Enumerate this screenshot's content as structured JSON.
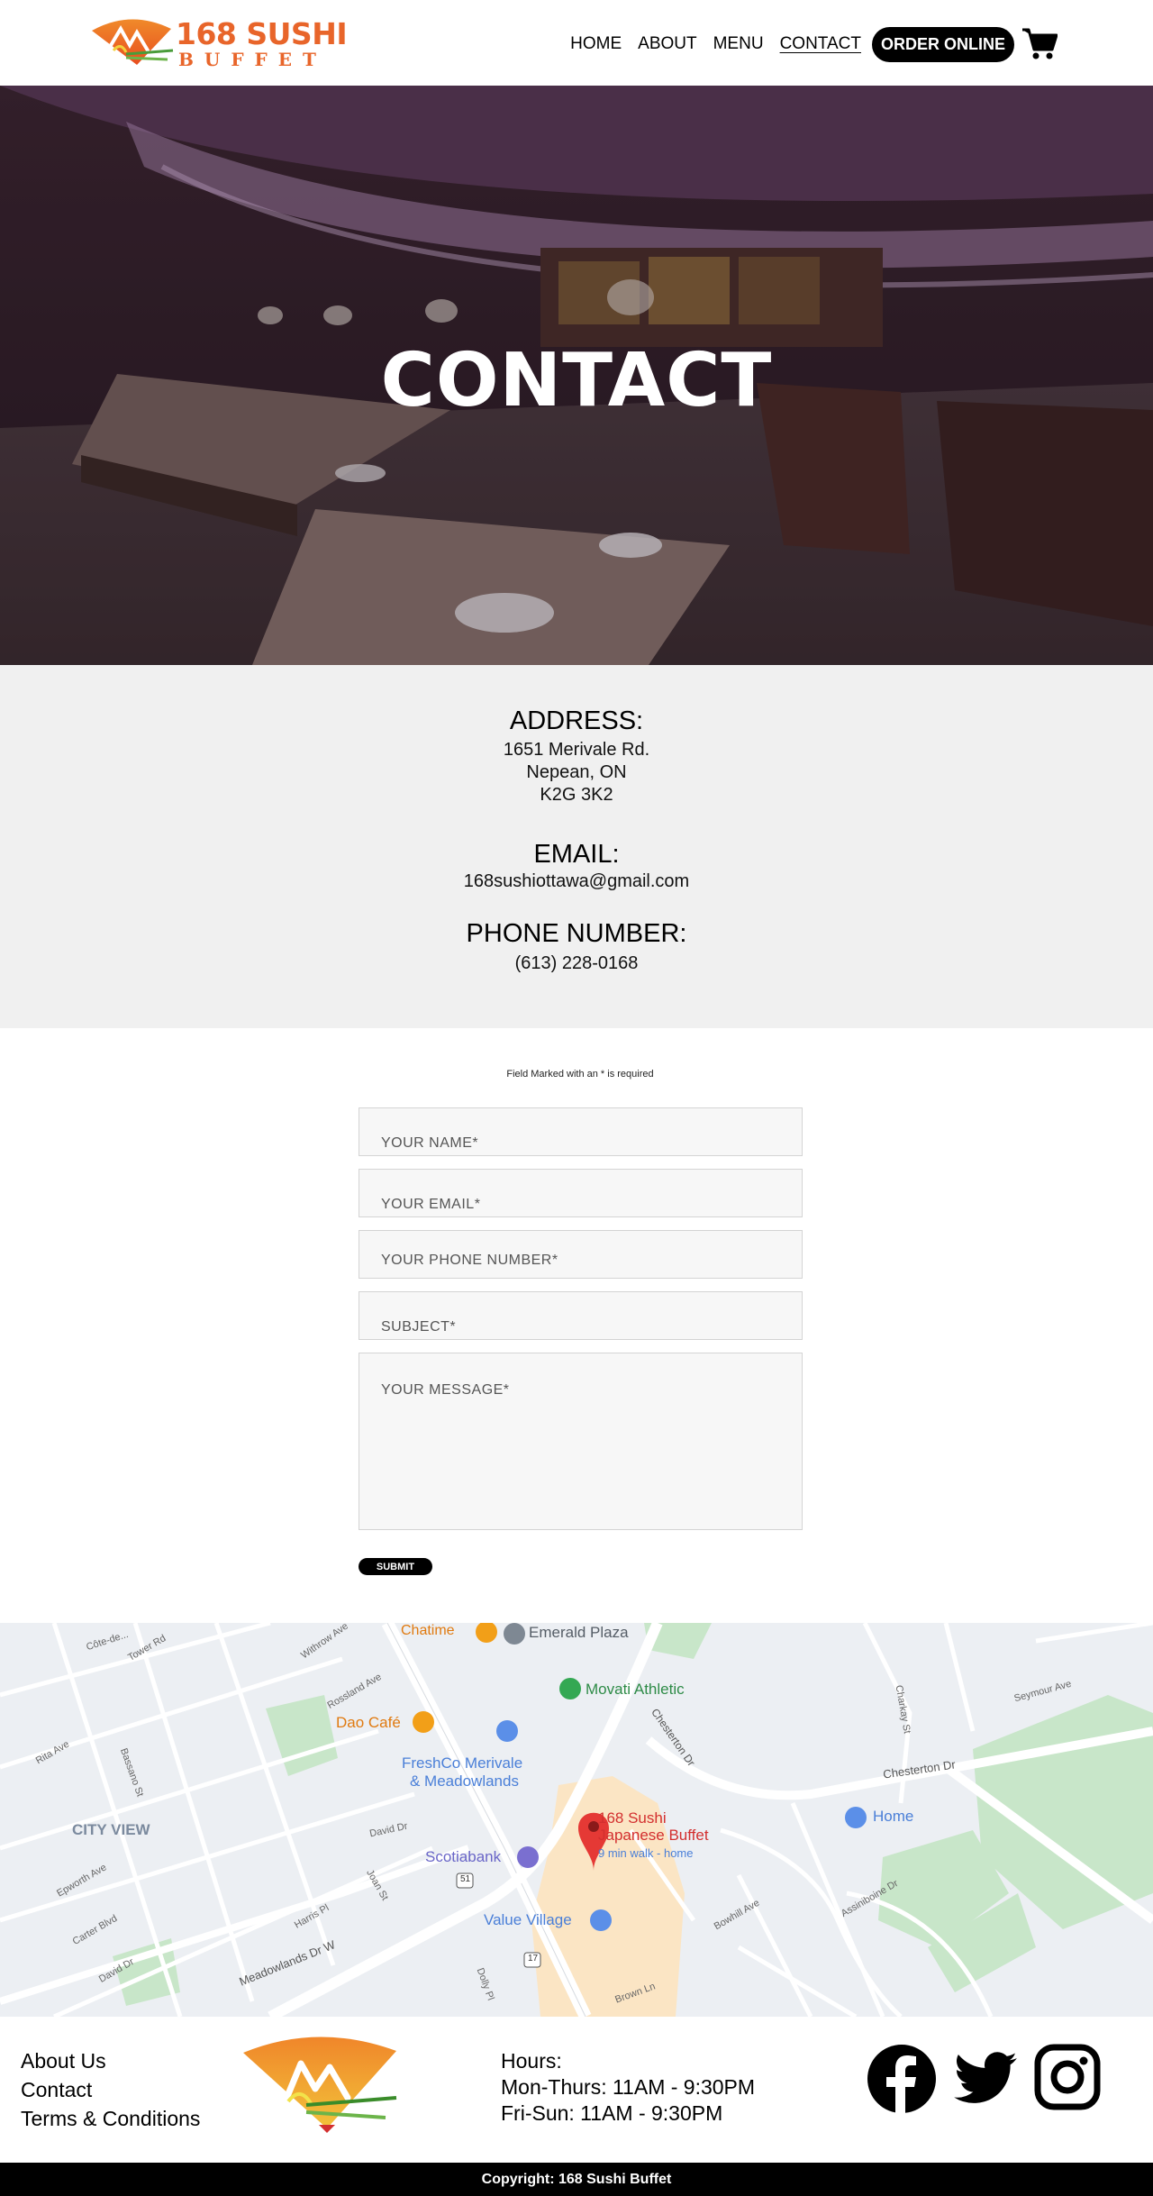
{
  "brand": {
    "name_top": "168 SUSHI",
    "name_bottom": "BUFFET",
    "orange": "#e8652a"
  },
  "nav": {
    "items": [
      {
        "label": "HOME"
      },
      {
        "label": "ABOUT"
      },
      {
        "label": "MENU"
      },
      {
        "label": "CONTACT",
        "active": true
      }
    ],
    "order_label": "ORDER ONLINE",
    "cart_icon": "cart-icon"
  },
  "hero": {
    "title": "CONTACT"
  },
  "info": {
    "address_heading": "ADDRESS:",
    "address_line1": "1651 Merivale Rd.",
    "address_line2": "Nepean, ON",
    "address_line3": "K2G 3K2",
    "email_heading": "EMAIL:",
    "email": "168sushiottawa@gmail.com",
    "phone_heading": "PHONE NUMBER:",
    "phone": "(613) 228-0168"
  },
  "form": {
    "note": "Field Marked with an * is required",
    "name_placeholder": "YOUR NAME*",
    "email_placeholder": "YOUR EMAIL*",
    "phone_placeholder": "YOUR PHONE NUMBER*",
    "subject_placeholder": "SUBJECT*",
    "message_placeholder": "YOUR MESSAGE*",
    "submit_label": "SUBMIT"
  },
  "map": {
    "places": {
      "chatime": "Chatime",
      "emerald_plaza": "Emerald Plaza",
      "movati": "Movati Athletic",
      "dao_cafe": "Dao Café",
      "freshco_1": "FreshCo Merivale",
      "freshco_2": "& Meadowlands",
      "city_view": "CITY VIEW",
      "sushi_1": "168 Sushi",
      "sushi_2": "Japanese Buffet",
      "walk": "9 min walk - home",
      "home": "Home",
      "scotiabank": "Scotiabank",
      "value_village": "Value Village"
    },
    "streets": {
      "cote": "Côte-de...",
      "tower": "Tower Rd",
      "withrow": "Withrow Ave",
      "rossland": "Rossland Ave",
      "chesterton_dr": "Chesterton Dr",
      "chesterton_dr2": "Chesterton Dr",
      "rita": "Rita Ave",
      "bassano": "Bassano St",
      "david": "David Dr",
      "david2": "David Dr",
      "epworth": "Epworth Ave",
      "carter": "Carter Blvd",
      "harris": "Harris Pl",
      "joan": "Joan St",
      "meadowlands": "Meadowlands Dr W",
      "bowhill": "Bowhill Ave",
      "assiniboine": "Assiniboine Dr",
      "seymour": "Seymour Ave",
      "chartrey": "Charkay St",
      "route51": "51",
      "route17": "17",
      "brown": "Brown Ln",
      "dolly": "Dolly Pl"
    }
  },
  "footer": {
    "links": [
      "About Us",
      "Contact",
      "Terms & Conditions"
    ],
    "hours_heading": "Hours:",
    "hours_weekday": "Mon-Thurs: 11AM - 9:30PM",
    "hours_weekend": "Fri-Sun: 11AM - 9:30PM",
    "social_icons": [
      "facebook-icon",
      "twitter-icon",
      "instagram-icon"
    ],
    "copyright": "Copyright: 168 Sushi Buffet"
  }
}
